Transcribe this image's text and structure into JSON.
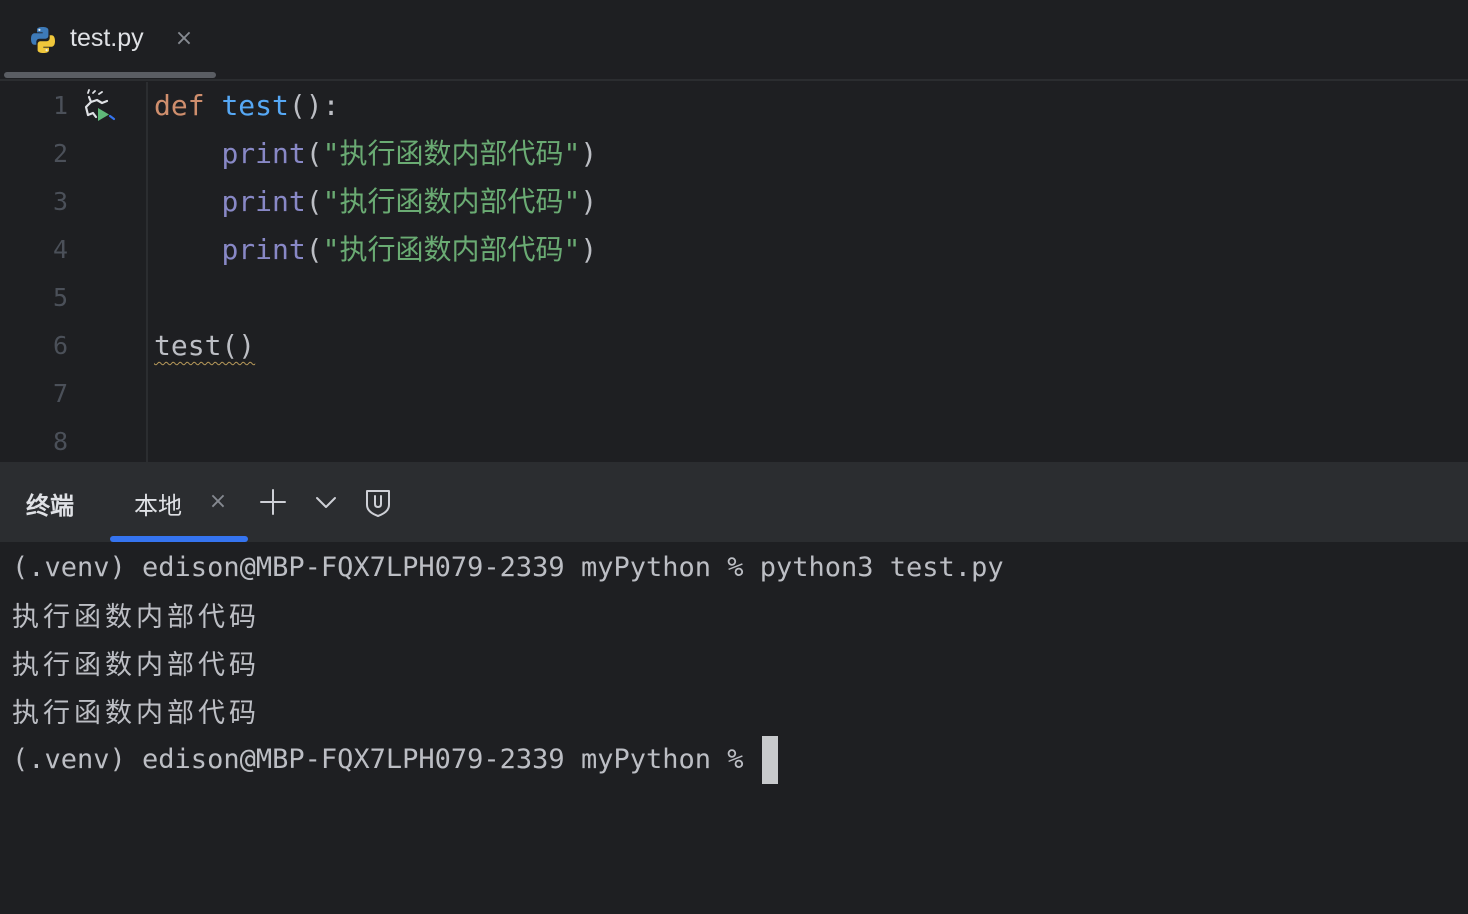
{
  "editor_tab": {
    "label": "test.py",
    "close": "×"
  },
  "code": {
    "line_numbers": [
      "1",
      "2",
      "3",
      "4",
      "5",
      "6",
      "7",
      "8"
    ],
    "lines": [
      {
        "kw": "def",
        "space": " ",
        "fn": "test",
        "punc": "():"
      },
      {
        "indent": "    ",
        "builtin": "print",
        "open": "(",
        "str": "\"执行函数内部代码\"",
        "close": ")"
      },
      {
        "indent": "    ",
        "builtin": "print",
        "open": "(",
        "str": "\"执行函数内部代码\"",
        "close": ")"
      },
      {
        "indent": "    ",
        "builtin": "print",
        "open": "(",
        "str": "\"执行函数内部代码\"",
        "close": ")"
      },
      {
        "text": "test()"
      }
    ]
  },
  "terminal": {
    "title": "终端",
    "tab_label": "本地",
    "tab_close": "×",
    "lines": [
      "(.venv) edison@MBP-FQX7LPH079-2339 myPython % python3 test.py",
      "执行函数内部代码",
      "执行函数内部代码",
      "执行函数内部代码"
    ],
    "prompt": "(.venv) edison@MBP-FQX7LPH079-2339 myPython % "
  },
  "icons": {
    "file": "python-icon",
    "gutter_run": "run-icon",
    "new_tab": "plus-icon",
    "dropdown": "chevron-down-icon",
    "shield": "shield-icon"
  },
  "colors": {
    "background": "#1e1f22",
    "panel_header": "#2b2d30",
    "accent": "#3574f0",
    "keyword": "#cf8e6d",
    "function": "#56a8f5",
    "builtin": "#8888c6",
    "string": "#6aab73"
  }
}
